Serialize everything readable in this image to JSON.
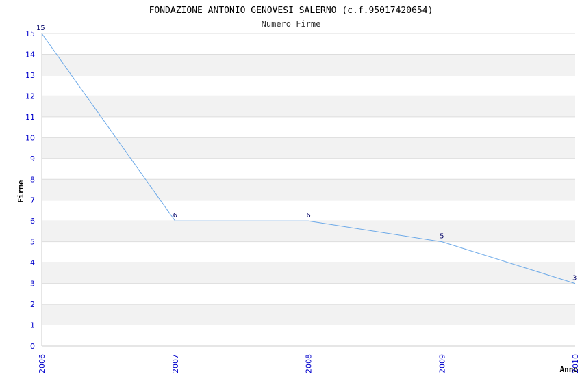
{
  "chart_data": {
    "type": "line",
    "title": "FONDAZIONE ANTONIO GENOVESI SALERNO (c.f.95017420654)",
    "subtitle": "Numero Firme",
    "xlabel": "Anno",
    "ylabel": "Firme",
    "x": [
      "2006",
      "2007",
      "2008",
      "2009",
      "2010"
    ],
    "values": [
      15,
      6,
      6,
      5,
      3
    ],
    "data_labels": [
      "15",
      "6",
      "6",
      "5",
      "3"
    ],
    "ylim": [
      0,
      15
    ],
    "yticks": [
      "0",
      "1",
      "2",
      "3",
      "4",
      "5",
      "6",
      "7",
      "8",
      "9",
      "10",
      "11",
      "12",
      "13",
      "14",
      "15"
    ],
    "grid": true,
    "colors": {
      "line": "#6aa8e8",
      "band": "#f2f2f2",
      "gridline": "#dddddd",
      "tick_text": "#0000cc",
      "data_label": "#000066"
    }
  }
}
